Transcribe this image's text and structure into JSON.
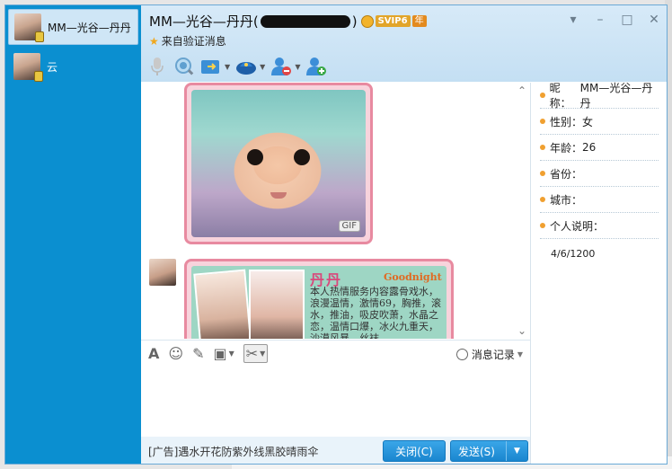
{
  "window": {
    "title_name": "MM—光谷—丹丹",
    "title_paren_open": "(",
    "title_paren_close": ")",
    "vip_label": "SVIP6",
    "vip_year_label": "年",
    "subtitle": "来自验证消息"
  },
  "sidebar": {
    "items": [
      {
        "name": "MM—光谷—丹丹",
        "active": true
      },
      {
        "name": "云",
        "active": false
      }
    ]
  },
  "window_controls": [
    "▾",
    "–",
    "□",
    "✕"
  ],
  "toolbar": {
    "icons": [
      "microphone-icon",
      "video-icon",
      "file-transfer-icon",
      "app-icon",
      "remove-contact-icon",
      "add-contact-icon"
    ]
  },
  "chat": {
    "gif_label": "GIF",
    "card": {
      "title": "丹丹",
      "subtitle": "Goodnight",
      "text": "本人热情服务内容露骨戏水，浪漫温情，激情69，胸推，滚水，推油，吸皮吹萧，水晶之恋，温情口爆，冰火九重天，沙漠风暴，丝袜"
    }
  },
  "input_toolbar": {
    "history_label": "消息记录"
  },
  "footer": {
    "ad_text": "[广告]遇水开花防紫外线黑胶晴雨伞",
    "close_label": "关闭(C)",
    "send_label": "发送(S)"
  },
  "profile": {
    "rows": [
      {
        "label": "昵称：",
        "value": "MM—光谷—丹丹"
      },
      {
        "label": "性别：",
        "value": "女"
      },
      {
        "label": "年龄：",
        "value": "26"
      },
      {
        "label": "省份：",
        "value": ""
      },
      {
        "label": "城市：",
        "value": ""
      },
      {
        "label": "个人说明：",
        "value": ""
      }
    ],
    "extra": "4/6/1200"
  }
}
